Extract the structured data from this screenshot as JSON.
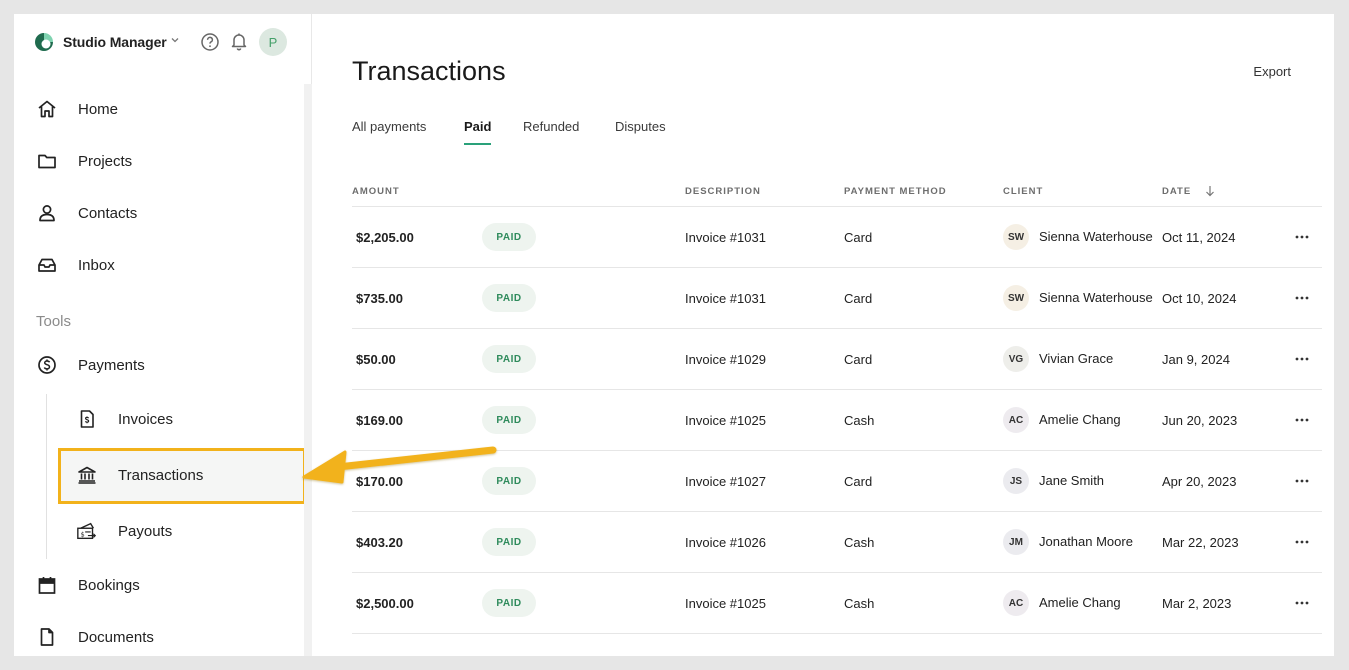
{
  "sidebar": {
    "studio_name": "Studio Manager",
    "avatar_initial": "P",
    "nav": [
      {
        "label": "Home",
        "icon": "home-icon"
      },
      {
        "label": "Projects",
        "icon": "folder-icon"
      },
      {
        "label": "Contacts",
        "icon": "person-icon"
      },
      {
        "label": "Inbox",
        "icon": "inbox-icon"
      }
    ],
    "tools_label": "Tools",
    "payments": {
      "label": "Payments",
      "icon": "dollar-circle-icon"
    },
    "sub": [
      {
        "label": "Invoices",
        "icon": "invoice-icon"
      },
      {
        "label": "Transactions",
        "icon": "bank-icon"
      },
      {
        "label": "Payouts",
        "icon": "payout-icon"
      }
    ],
    "bottom": [
      {
        "label": "Bookings",
        "icon": "calendar-icon"
      },
      {
        "label": "Documents",
        "icon": "document-icon"
      }
    ]
  },
  "main": {
    "title": "Transactions",
    "export_label": "Export",
    "tabs": [
      {
        "label": "All payments"
      },
      {
        "label": "Paid"
      },
      {
        "label": "Refunded"
      },
      {
        "label": "Disputes"
      }
    ],
    "active_tab": "Paid",
    "columns": {
      "amount": "AMOUNT",
      "description": "DESCRIPTION",
      "method": "PAYMENT METHOD",
      "client": "CLIENT",
      "date": "DATE"
    },
    "rows": [
      {
        "amount": "$2,205.00",
        "status": "PAID",
        "description": "Invoice #1031",
        "method": "Card",
        "initials": "SW",
        "client": "Sienna Waterhouse",
        "date": "Oct 11, 2024"
      },
      {
        "amount": "$735.00",
        "status": "PAID",
        "description": "Invoice #1031",
        "method": "Card",
        "initials": "SW",
        "client": "Sienna Waterhouse",
        "date": "Oct 10, 2024"
      },
      {
        "amount": "$50.00",
        "status": "PAID",
        "description": "Invoice #1029",
        "method": "Card",
        "initials": "VG",
        "client": "Vivian Grace",
        "date": "Jan 9, 2024"
      },
      {
        "amount": "$169.00",
        "status": "PAID",
        "description": "Invoice #1025",
        "method": "Cash",
        "initials": "AC",
        "client": "Amelie Chang",
        "date": "Jun 20, 2023"
      },
      {
        "amount": "$170.00",
        "status": "PAID",
        "description": "Invoice #1027",
        "method": "Card",
        "initials": "JS",
        "client": "Jane Smith",
        "date": "Apr 20, 2023"
      },
      {
        "amount": "$403.20",
        "status": "PAID",
        "description": "Invoice #1026",
        "method": "Cash",
        "initials": "JM",
        "client": "Jonathan Moore",
        "date": "Mar 22, 2023"
      },
      {
        "amount": "$2,500.00",
        "status": "PAID",
        "description": "Invoice #1025",
        "method": "Cash",
        "initials": "AC",
        "client": "Amelie Chang",
        "date": "Mar 2, 2023"
      }
    ]
  },
  "colors": {
    "accent": "#2aa17a",
    "highlight": "#f2b21b",
    "badge_bg": "#eef4ef",
    "badge_text": "#2f8b5c"
  }
}
